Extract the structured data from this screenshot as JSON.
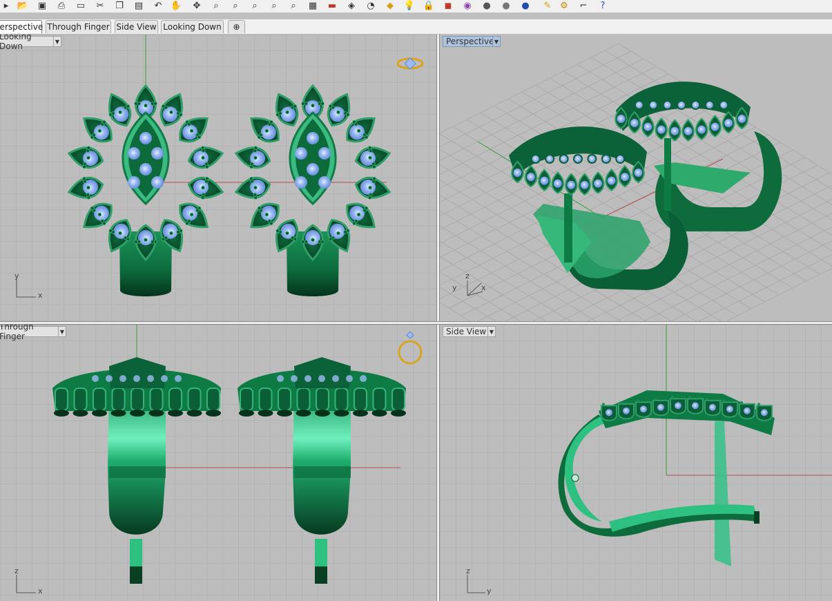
{
  "toolbar": {
    "icons": [
      "select-icon",
      "open-icon",
      "save-icon",
      "print-icon",
      "new-icon",
      "cut-icon",
      "copy-icon",
      "paste-icon",
      "undo-icon",
      "pan-icon",
      "rotate-view-icon",
      "zoom-dynamic-icon",
      "zoom-window-icon",
      "zoom-extents-icon",
      "zoom-selected-icon",
      "zoom-all-icon",
      "grid-icon",
      "car-icon",
      "camera-icon",
      "dimension-icon",
      "layers-icon",
      "light-icon",
      "lock-icon",
      "material-icon",
      "color-wheel-icon",
      "render-sphere-icon",
      "render-preview-icon",
      "environment-sphere-icon",
      "pencil-icon",
      "gear-icon",
      "curve-tool-icon",
      "help-icon"
    ]
  },
  "tabs": [
    {
      "label": "Perspective",
      "active": true
    },
    {
      "label": "Through Finger",
      "active": false
    },
    {
      "label": "Side View",
      "active": false
    },
    {
      "label": "Looking Down",
      "active": false
    }
  ],
  "add_tab_label": "⊕",
  "viewports": {
    "top_left": {
      "label": "Looking Down",
      "axis_a": "y",
      "axis_b": "x"
    },
    "top_right": {
      "label": "Perspective",
      "axis_a": "z",
      "axis_b": "y",
      "axis_c": "x"
    },
    "bottom_left": {
      "label": "Through Finger",
      "axis_a": "z",
      "axis_b": "x"
    },
    "bottom_right": {
      "label": "Side View",
      "axis_a": "z",
      "axis_b": "y"
    }
  },
  "colors": {
    "viewport_bg": "#bdbdbd",
    "grid": "#a9a9a9",
    "x_axis": "#b34a4a",
    "y_axis": "#3d9a3d",
    "model_green": "#0e7b45",
    "model_light": "#3fbf8a",
    "gem_blue": "#8fb2f0"
  }
}
